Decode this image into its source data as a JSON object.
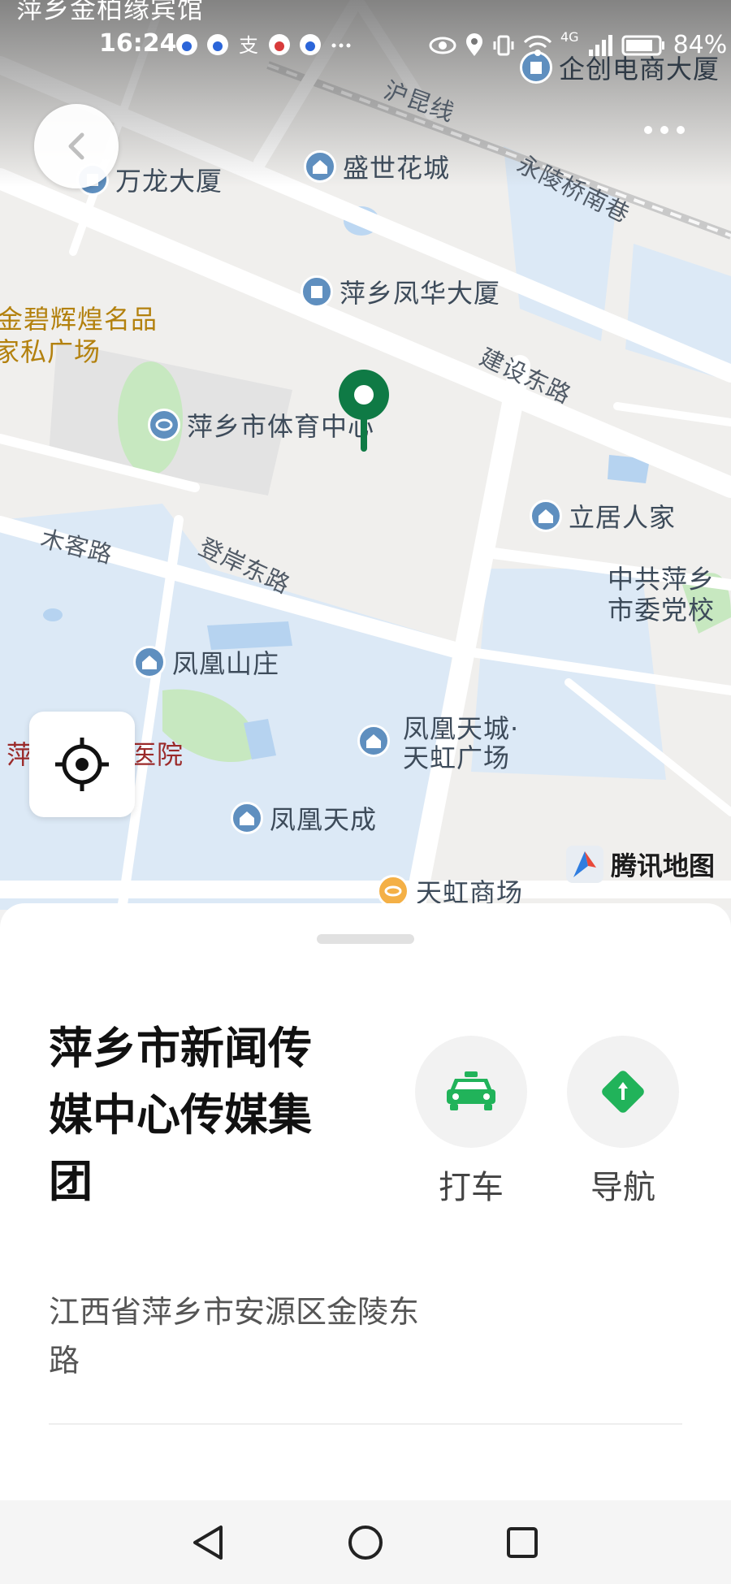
{
  "status_bar": {
    "time": "16:24",
    "network": "4G",
    "battery": "84%"
  },
  "map": {
    "labels": {
      "top_cut": "萍乡金柏缘宾馆",
      "qichuang": "企创电商大厦",
      "hukun": "沪昆线",
      "wanlong": "万龙大厦",
      "shengshi": "盛世花城",
      "yongling": "永陵桥南巷",
      "fenghua": "萍乡凤华大厦",
      "jinbi_1": "金碧辉煌名品",
      "jinbi_2": "家私广场",
      "jianshe": "建设东路",
      "tiyu": "萍乡市体育中心",
      "liju": "立居人家",
      "muke": "木客路",
      "dengan": "登岸东路",
      "dangxiao_1": "中共萍乡",
      "dangxiao_2": "市委党校",
      "fenghuang_shanzhuang": "凤凰山庄",
      "tiancheng_1": "凤凰天城·",
      "tiancheng_2": "天虹广场",
      "hospital_l": "萍",
      "hospital_r": "医院",
      "fenghuang_tiancheng": "凤凰天成",
      "tianhong": "天虹商场"
    },
    "brand": "腾讯地图"
  },
  "place": {
    "name": "萍乡市新闻传媒中心传媒集团",
    "address": "江西省萍乡市安源区金陵东路",
    "actions": [
      {
        "label": "打车",
        "icon": "taxi-icon",
        "color": "#21b35a"
      },
      {
        "label": "导航",
        "icon": "navigation-icon",
        "color": "#21b35a"
      }
    ]
  },
  "colors": {
    "accent": "#21b35a",
    "marker": "#0f7a45",
    "water": "#bcd7f2",
    "park": "#c7e8c0",
    "residential": "#dce9f6"
  }
}
